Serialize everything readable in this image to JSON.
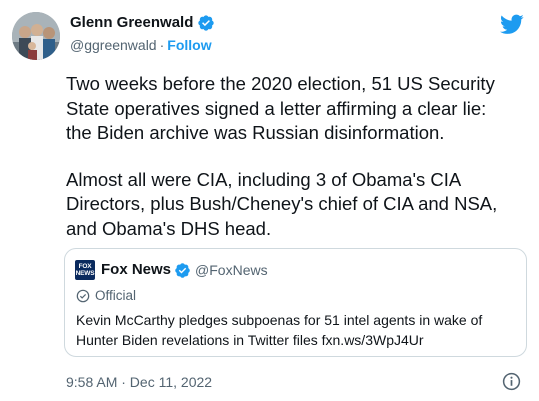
{
  "author": {
    "display_name": "Glenn Greenwald",
    "handle": "@ggreenwald",
    "separator": "·",
    "follow_label": "Follow",
    "verified_icon": "verified-badge-icon"
  },
  "logo_icon": "twitter-bird-icon",
  "tweet": {
    "paragraphs": [
      "Two weeks before the 2020 election, 51 US Security\nState operatives signed a letter affirming a clear lie:\nthe Biden archive was Russian disinformation.",
      "Almost all were CIA, including 3 of Obama's CIA\nDirectors, plus Bush/Cheney's chief of CIA and NSA,\nand Obama's DHS head."
    ]
  },
  "quote": {
    "avatar_text": [
      "FOX",
      "NEWS"
    ],
    "display_name": "Fox News",
    "handle": "@FoxNews",
    "official_label": "Official",
    "text": "Kevin McCarthy pledges subpoenas for 51 intel agents in wake of Hunter Biden revelations in Twitter files fxn.ws/3WpJ4Ur"
  },
  "footer": {
    "timestamp": "9:58 AM · Dec 11, 2022",
    "info_icon": "info-icon"
  },
  "colors": {
    "accent": "#1d9bf0",
    "text": "#0f1419",
    "secondary_text": "#536471",
    "border": "#cfd9de"
  }
}
